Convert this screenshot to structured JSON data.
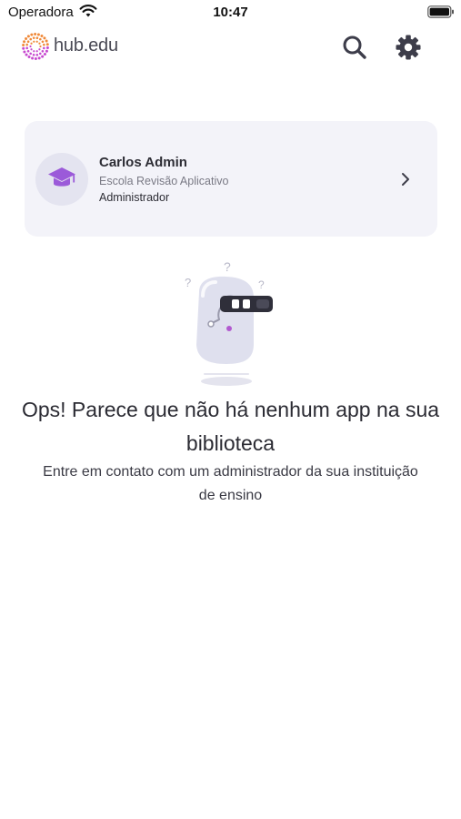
{
  "status_bar": {
    "carrier": "Operadora",
    "time": "10:47",
    "wifi_icon": "wifi-icon",
    "battery_icon": "battery-icon"
  },
  "header": {
    "brand": "hub.edu",
    "logo_icon": "sunburst-logo-icon",
    "search_icon": "search-icon",
    "settings_icon": "gear-icon"
  },
  "profile": {
    "name": "Carlos Admin",
    "school": "Escola Revisão Aplicativo",
    "role": "Administrador",
    "avatar_icon": "graduation-cap-icon",
    "chevron_icon": "chevron-right-icon"
  },
  "empty_state": {
    "illustration": "confused-robot-vr-headset-illustration",
    "title": "Ops! Parece que não há nenhum app na sua biblioteca",
    "subtitle": "Entre em contato com um administrador da sua instituição de ensino"
  },
  "colors": {
    "accent_purple": "#9b5ad9",
    "logo_orange": "#f08a3a",
    "logo_magenta": "#c74ad0",
    "icon_dark": "#3d3d4a",
    "card_bg": "#f3f3f9",
    "avatar_bg": "#e4e4f0"
  }
}
